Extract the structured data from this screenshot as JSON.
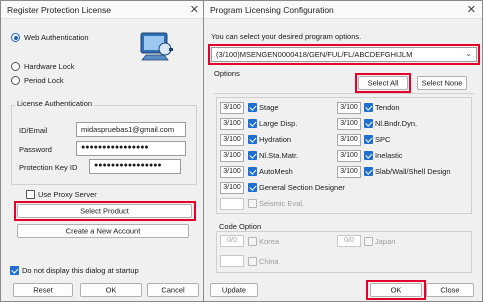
{
  "left_dialog": {
    "title": "Register Protection License",
    "auth_modes": [
      "Web Authentication",
      "Hardware Lock",
      "Period Lock"
    ],
    "license_group_title": "License Authentication",
    "id_label": "ID/Email",
    "id_value": "midaspruebas1@gmail.com",
    "password_label": "Password",
    "password_value": "●●●●●●●●●●●●●●●●",
    "protection_key_label": "Protection Key ID",
    "protection_key_value": "●●●●●●●●●●●●●●●●",
    "proxy_label": "Use Proxy Server",
    "select_product": "Select Product",
    "create_account": "Create a New Account",
    "dont_display": "Do not display this dialog at startup",
    "reset": "Reset",
    "ok": "OK",
    "cancel": "Cancel"
  },
  "right_dialog": {
    "title": "Program Licensing Configuration",
    "hint": "You can select your desired program options.",
    "license_select": "(3/100)MSENGEN0000418/GEN/FUL/FL/ABCDEFGHIJLM",
    "options_title": "Options",
    "select_all": "Select All",
    "select_none": "Select None",
    "options_left": [
      {
        "ver": "3/100",
        "label": "Stage",
        "checked": true
      },
      {
        "ver": "3/100",
        "label": "Large Disp.",
        "checked": true
      },
      {
        "ver": "3/100",
        "label": "Hydration",
        "checked": true
      },
      {
        "ver": "3/100",
        "label": "Nl.Sta.Matr.",
        "checked": true
      },
      {
        "ver": "3/100",
        "label": "AutoMesh",
        "checked": true
      },
      {
        "ver": "3/100",
        "label": "General Section Designer",
        "checked": true
      },
      {
        "ver": "",
        "label": "Seismic Eval.",
        "checked": false
      }
    ],
    "options_right": [
      {
        "ver": "3/100",
        "label": "Tendon",
        "checked": true
      },
      {
        "ver": "3/100",
        "label": "Nl.Bndr.Dyn.",
        "checked": true
      },
      {
        "ver": "3/100",
        "label": "SPC",
        "checked": true
      },
      {
        "ver": "3/100",
        "label": "Inelastic",
        "checked": true
      },
      {
        "ver": "3/100",
        "label": "Slab/Wall/Shell Design",
        "checked": true
      }
    ],
    "code_title": "Code Option",
    "code_options": [
      {
        "ver": "0/0",
        "label": "Korea"
      },
      {
        "ver": "0/0",
        "label": "Japan"
      },
      {
        "ver": "",
        "label": "China"
      }
    ],
    "update": "Update",
    "ok": "OK",
    "close": "Close"
  },
  "colors": {
    "highlight": "#e4002b",
    "check_blue": "#1e6fd0"
  }
}
